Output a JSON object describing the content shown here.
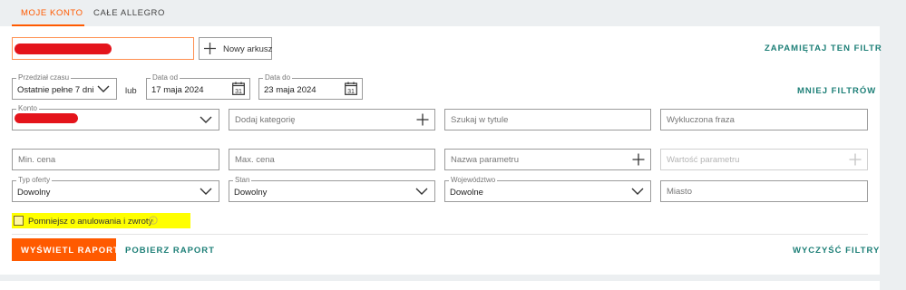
{
  "tabs": {
    "my_account": "MOJE KONTO",
    "all_allegro": "CAŁE ALLEGRO"
  },
  "sheet": {
    "new_sheet_label": "Nowy arkusz",
    "save_filter": "ZAPAMIĘTAJ TEN FILTR"
  },
  "filters": {
    "period": {
      "legend": "Przedział czasu",
      "value": "Ostatnie pełne 7 dni"
    },
    "or_label": "lub",
    "date_from": {
      "legend": "Data od",
      "value": "17 maja 2024",
      "calendar_day": "31"
    },
    "date_to": {
      "legend": "Data do",
      "value": "23 maja 2024",
      "calendar_day": "31"
    },
    "fewer_filters": "MNIEJ FILTRÓW",
    "account": {
      "legend": "Konto"
    },
    "category": {
      "placeholder": "Dodaj kategorię"
    },
    "title_search": {
      "placeholder": "Szukaj w tytule"
    },
    "excluded_phrase": {
      "placeholder": "Wykluczona fraza"
    },
    "min_price": {
      "placeholder": "Min. cena"
    },
    "max_price": {
      "placeholder": "Max. cena"
    },
    "param_name": {
      "placeholder": "Nazwa parametru"
    },
    "param_value": {
      "placeholder": "Wartość parametru"
    },
    "offer_type": {
      "legend": "Typ oferty",
      "value": "Dowolny"
    },
    "condition": {
      "legend": "Stan",
      "value": "Dowolny"
    },
    "province": {
      "legend": "Województwo",
      "value": "Dowolne"
    },
    "city": {
      "placeholder": "Miasto"
    },
    "reduce_checkbox": {
      "label": "Pomniejsz o anulowania i zwroty",
      "checked": false
    }
  },
  "actions": {
    "show_report": "WYŚWIETL RAPORT",
    "download_report": "POBIERZ RAPORT",
    "clear_filters": "WYCZYŚĆ FILTRY"
  },
  "colors": {
    "accent": "#ff5a00",
    "link": "#1d7f77",
    "highlight": "#ffff00",
    "redaction": "#e4141b"
  }
}
